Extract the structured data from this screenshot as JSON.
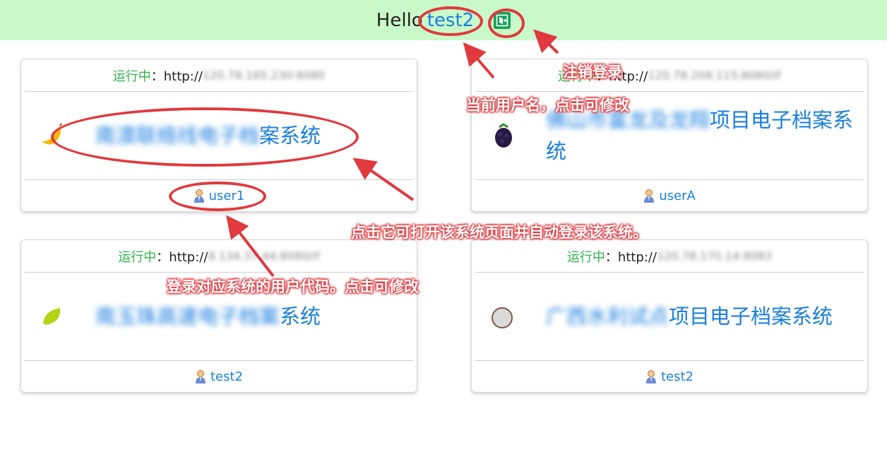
{
  "header": {
    "greeting": "Hello",
    "username": "test2",
    "logout_icon": "exit-door-icon"
  },
  "cards": [
    {
      "status": "运行中",
      "url_prefix": "：http://",
      "url": "120.78.165.230:8080",
      "logo": "banana-icon",
      "name_hidden": "南澳联络线电子档",
      "name_visible": "案系统",
      "user": "user1"
    },
    {
      "status": "运行中",
      "url_prefix": "：http://",
      "url": "120.78.208.115:8080/if",
      "logo": "blackberry-icon",
      "name_hidden": "佛山市富龙及龙翔",
      "name_visible": "项目电子档案系统",
      "user": "userA"
    },
    {
      "status": "运行中",
      "url_prefix": "：http://",
      "url": "8.134.37.44:8080/if",
      "logo": "lime-slice-icon",
      "name_hidden": "南玉珠高速电子档案",
      "name_visible": "系统",
      "user": "test2"
    },
    {
      "status": "运行中",
      "url_prefix": "：http://",
      "url": "120.78.170.14:8083",
      "logo": "grey-circle-icon",
      "name_hidden": "广西水利试点",
      "name_visible": "项目电子档案系统",
      "user": "test2"
    }
  ],
  "annotations": {
    "logout": "注销登录",
    "username": "当前用户名，点击可修改",
    "open_system": "点击它可打开该系统页面并自动登录该系统。",
    "user_code": "登录对应系统的用户代码。点击可修改"
  },
  "colors": {
    "topbar": "#c9f8c9",
    "link": "#1a7fe0",
    "status": "#2db54a",
    "annotation": "#e0393e"
  }
}
